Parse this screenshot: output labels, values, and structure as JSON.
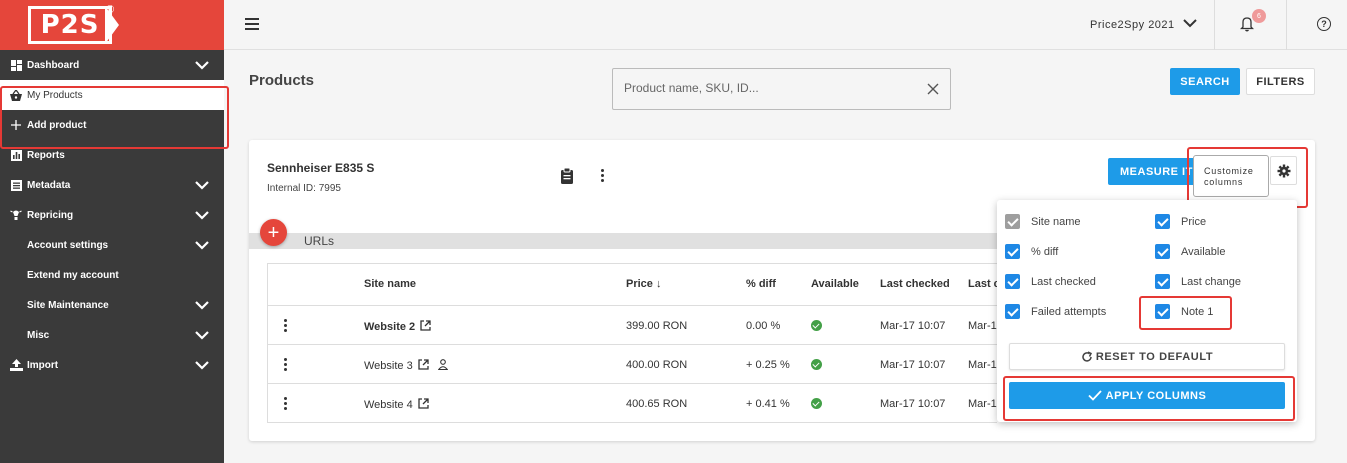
{
  "brand": {
    "logo_text": "P2S",
    "registered": "®"
  },
  "sidebar": {
    "items": [
      {
        "label": "Dashboard",
        "icon": "dashboard-icon",
        "expandable": true
      },
      {
        "label": "My Products",
        "icon": "basket-icon",
        "active": true
      },
      {
        "label": "Add product",
        "icon": "plus-icon"
      },
      {
        "label": "Reports",
        "icon": "bar-chart-icon"
      },
      {
        "label": "Metadata",
        "icon": "list-icon",
        "expandable": true
      },
      {
        "label": "Repricing",
        "icon": "lightbulb-icon",
        "expandable": true
      },
      {
        "label": "Account settings",
        "expandable": true
      },
      {
        "label": "Extend my account"
      },
      {
        "label": "Site Maintenance",
        "expandable": true
      },
      {
        "label": "Misc",
        "expandable": true
      },
      {
        "label": "Import",
        "icon": "upload-icon",
        "expandable": true
      }
    ]
  },
  "topbar": {
    "workspace": "Price2Spy 2021",
    "notification_count": "6",
    "help": "?"
  },
  "page": {
    "title": "Products",
    "search_placeholder": "Product name, SKU, ID...",
    "search_button": "SEARCH",
    "filters_button": "FILTERS"
  },
  "product": {
    "name": "Sennheiser E835 S",
    "internal_id": "Internal ID: 7995",
    "measure_button": "MEASURE IT",
    "customize_tooltip_line1": "Customize",
    "customize_tooltip_line2": "columns",
    "urls_label": "URLs",
    "add_url": "+"
  },
  "table": {
    "headers": {
      "site_name": "Site name",
      "price": "Price",
      "price_sort": "↓",
      "diff": "% diff",
      "available": "Available",
      "last_checked": "Last checked",
      "last_change": "Last c"
    },
    "rows": [
      {
        "site": "Website 2",
        "price": "399.00  RON",
        "diff": "0.00 %",
        "checked": "Mar-17 10:07",
        "change": "Mar-1"
      },
      {
        "site": "Website 3",
        "price": "400.00  RON",
        "diff": "+ 0.25 %",
        "checked": "Mar-17 10:07",
        "change": "Mar-1"
      },
      {
        "site": "Website 4",
        "price": "400.65  RON",
        "diff": "+ 0.41 %",
        "checked": "Mar-17 10:07",
        "change": "Mar-1"
      }
    ]
  },
  "columns_menu": {
    "options": [
      {
        "label": "Site name",
        "checked": true,
        "disabled": true
      },
      {
        "label": "Price",
        "checked": true
      },
      {
        "label": "% diff",
        "checked": true
      },
      {
        "label": "Available",
        "checked": true
      },
      {
        "label": "Last checked",
        "checked": true
      },
      {
        "label": "Last change",
        "checked": true
      },
      {
        "label": "Failed attempts",
        "checked": true
      },
      {
        "label": "Note 1",
        "checked": true
      }
    ],
    "reset_button": "RESET TO DEFAULT",
    "apply_button": "APPLY COLUMNS"
  },
  "colors": {
    "brand_red": "#e5463b",
    "primary_blue": "#1e9be8",
    "sidebar_bg": "#3a3a3a",
    "highlight_red": "#e53935",
    "available_green": "#43a047"
  }
}
